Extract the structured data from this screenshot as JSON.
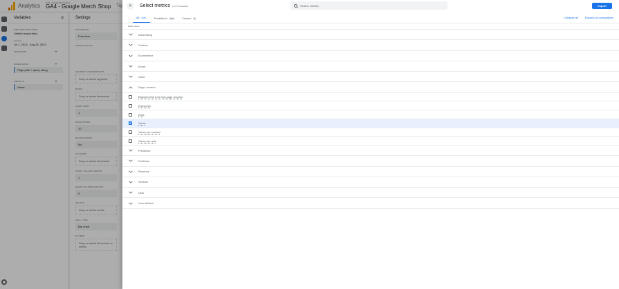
{
  "app": {
    "name": "Analytics",
    "account_crumb": "GA4 - Google Merch Shop",
    "property": "GA4 - Google Merch Shop",
    "search_hint": "Try"
  },
  "variables": {
    "title": "Variables",
    "exploration_name_label": "EXPLORATION NAME:",
    "exploration_name": "Untitled exploration",
    "custom_label": "Custom",
    "date_range": "Jul 1, 2023 - Aug 25, 2023",
    "segments_label": "SEGMENTS",
    "dimensions_label": "DIMENSIONS",
    "dimension_chip": "Page path + query string",
    "metrics_label": "METRICS",
    "metric_chip": "Views"
  },
  "settings": {
    "title": "Settings",
    "technique_label": "TECHNIQUE",
    "technique_value": "Free form",
    "visualization_label": "VISUALIZATION",
    "segment_comparisons_label": "SEGMENT COMPARISONS",
    "drop_segment": "Drop or select segment",
    "rows_label": "ROWS",
    "drop_dimension": "Drop or select dimension",
    "start_row_label": "START ROW",
    "start_row": "1",
    "show_rows_label": "SHOW ROWS",
    "show_rows": "10",
    "nested_rows_label": "NESTED ROWS",
    "nested_rows": "No",
    "columns_label": "COLUMNS",
    "drop_column_dimension": "Drop or select dimension",
    "start_column_group_label": "START COLUMN GROUP",
    "start_column_group": "1",
    "show_column_groups_label": "SHOW COLUMN GROUPS",
    "show_column_groups": "5",
    "values_label": "VALUES",
    "drop_metric": "Drop or select metric",
    "cell_type_label": "CELL TYPE",
    "cell_type": "Bar chart",
    "filters_label": "FILTERS",
    "drop_filter": "Drop or select dimension or metric"
  },
  "dialog": {
    "title": "Select metrics",
    "selected_count": "1 of 175 selected",
    "search_placeholder": "Search metrics",
    "import_label": "Import",
    "tabs": [
      {
        "label": "All",
        "count": "174"
      },
      {
        "label": "Predefined",
        "count": "169"
      },
      {
        "label": "Custom",
        "count": "8"
      }
    ],
    "collapse_all": "Collapse all",
    "expand_all": "Expand all compatibles",
    "column_header": "Metric name",
    "groups_before": [
      "Advertising",
      "Custom",
      "Ecommerce",
      "Event",
      "Other"
    ],
    "expanded_group": "Page / screen",
    "items": [
      {
        "label": "Elapsed time from last page request",
        "checked": false
      },
      {
        "label": "Entrances",
        "checked": false
      },
      {
        "label": "Exits",
        "checked": false
      },
      {
        "label": "Views",
        "checked": true
      },
      {
        "label": "Views per session",
        "checked": false
      },
      {
        "label": "Views per user",
        "checked": false
      }
    ],
    "groups_after": [
      "Predictive",
      "Publisher",
      "Revenue",
      "Session",
      "User",
      "User lifetime"
    ]
  }
}
